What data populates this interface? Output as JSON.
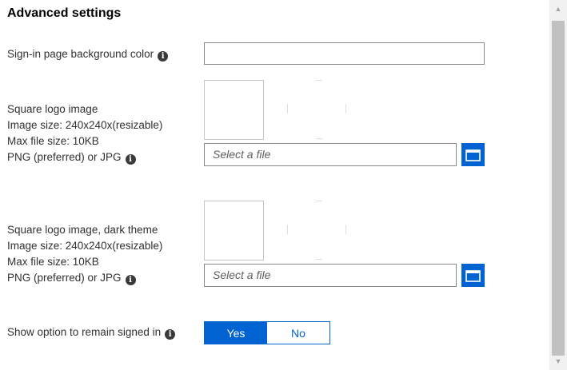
{
  "section": {
    "title": "Advanced settings"
  },
  "bg_color": {
    "label": "Sign-in page background color",
    "value": ""
  },
  "square_logo": {
    "lines": [
      "Square logo image",
      "Image size: 240x240x(resizable)",
      "Max file size: 10KB",
      "PNG (preferred) or JPG"
    ],
    "file_placeholder": "Select a file"
  },
  "square_logo_dark": {
    "lines": [
      "Square logo image, dark theme",
      "Image size: 240x240x(resizable)",
      "Max file size: 10KB",
      "PNG (preferred) or JPG"
    ],
    "file_placeholder": "Select a file"
  },
  "remain_signed_in": {
    "label": "Show option to remain signed in",
    "yes": "Yes",
    "no": "No",
    "selected": "Yes"
  },
  "icons": {
    "info": "info-icon",
    "browse": "folder-icon"
  },
  "colors": {
    "accent": "#0063d1",
    "text": "#323130"
  }
}
